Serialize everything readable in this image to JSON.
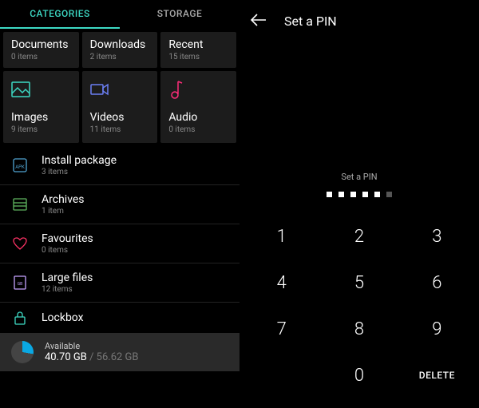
{
  "tabs": {
    "categories": "CATEGORIES",
    "storage": "STORAGE"
  },
  "tiles": {
    "documents": {
      "title": "Documents",
      "sub": "0 items"
    },
    "downloads": {
      "title": "Downloads",
      "sub": "2 items"
    },
    "recent": {
      "title": "Recent",
      "sub": "15 items"
    },
    "images": {
      "title": "Images",
      "sub": "9 items"
    },
    "videos": {
      "title": "Videos",
      "sub": "11 items"
    },
    "audio": {
      "title": "Audio",
      "sub": "0 items"
    }
  },
  "list": {
    "install": {
      "title": "Install package",
      "sub": "3 items"
    },
    "archives": {
      "title": "Archives",
      "sub": "1 item"
    },
    "favourites": {
      "title": "Favourites",
      "sub": "0 items"
    },
    "largefiles": {
      "title": "Large files",
      "sub": "12 items"
    },
    "lockbox": {
      "title": "Lockbox"
    }
  },
  "storage": {
    "label": "Available",
    "used": "40.70 GB",
    "sep": " / ",
    "total": "56.62 GB"
  },
  "pin": {
    "title": "Set a PIN",
    "hint": "Set a PIN",
    "keys": {
      "k1": "1",
      "k2": "2",
      "k3": "3",
      "k4": "4",
      "k5": "5",
      "k6": "6",
      "k7": "7",
      "k8": "8",
      "k9": "9",
      "k0": "0",
      "delete": "DELETE"
    }
  },
  "colors": {
    "accent": "#3dd9c4",
    "imagesIcon": "#3dd9c4",
    "videosIcon": "#6b7ff5",
    "audioIcon": "#ff2d7a",
    "favIcon": "#ff3366"
  }
}
